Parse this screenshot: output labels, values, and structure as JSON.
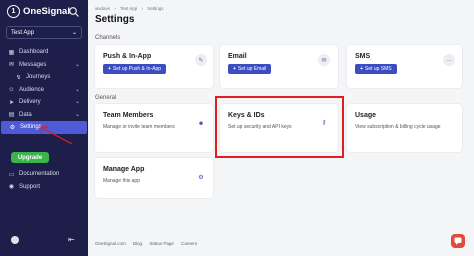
{
  "sidebar": {
    "brand": "OneSignal",
    "app_selector": "Test App",
    "items": [
      {
        "label": "Dashboard",
        "icon": "grid-icon"
      },
      {
        "label": "Messages",
        "icon": "message-icon",
        "expandable": true
      },
      {
        "label": "Journeys",
        "icon": "journey-icon"
      },
      {
        "label": "Audience",
        "icon": "people-icon",
        "expandable": true
      },
      {
        "label": "Delivery",
        "icon": "send-icon",
        "expandable": true
      },
      {
        "label": "Data",
        "icon": "chart-icon",
        "expandable": true
      },
      {
        "label": "Settings",
        "icon": "gear-icon",
        "active": true
      }
    ],
    "upgrade_label": "Upgrade",
    "bottom_items": [
      {
        "label": "Documentation",
        "icon": "book-icon"
      },
      {
        "label": "Support",
        "icon": "help-icon"
      }
    ]
  },
  "breadcrumb": [
    "wxdavs",
    "Test App",
    "Settings"
  ],
  "page_title": "Settings",
  "sections": {
    "channels": "Channels",
    "general": "General"
  },
  "channel_cards": [
    {
      "title": "Push & In-App",
      "button": "Set up Push & In-App",
      "icon": "edit-icon"
    },
    {
      "title": "Email",
      "button": "Set up Email",
      "icon": "mail-icon"
    },
    {
      "title": "SMS",
      "button": "Set up SMS",
      "icon": "chat-icon"
    }
  ],
  "general_cards": [
    {
      "title": "Team Members",
      "desc": "Manage or invite team members",
      "icon": "people-icon"
    },
    {
      "title": "Keys & IDs",
      "desc": "Set up security and API keys",
      "icon": "key-icon"
    },
    {
      "title": "Usage",
      "desc": "View subscription & billing cycle usage",
      "icon": ""
    },
    {
      "title": "Manage App",
      "desc": "Manage this app",
      "icon": "gear-icon"
    }
  ],
  "footer": [
    "OneSignal.com",
    "Blog",
    "Status Page",
    "Careers"
  ],
  "colors": {
    "sidebar_bg": "#1d1f4a",
    "accent": "#3b4dc0",
    "highlight": "#e11d23",
    "upgrade": "#39b54a"
  }
}
